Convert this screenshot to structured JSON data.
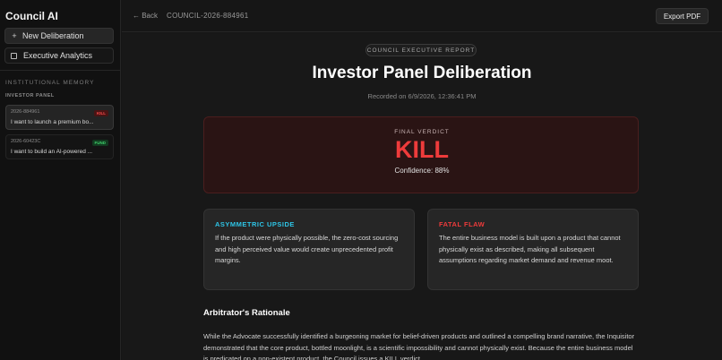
{
  "app": {
    "title": "Council AI"
  },
  "sidebar": {
    "new_label": "New Deliberation",
    "new_icon": "+",
    "analytics_label": "Executive Analytics",
    "memory_title": "INSTITUTIONAL MEMORY",
    "panel_title": "INVESTOR PANEL",
    "sessions": [
      {
        "id": "2026-884961",
        "text": "I want to launch a premium bo...",
        "badge": "KILL",
        "active": true
      },
      {
        "id": "2026-60423C",
        "text": "I want to build an AI-powered ...",
        "badge": "FUND",
        "active": false
      }
    ]
  },
  "topbar": {
    "back_label": "← Back",
    "crumb": "COUNCIL-2026-884961",
    "export_label": "Export PDF"
  },
  "report": {
    "tag": "COUNCIL EXECUTIVE REPORT",
    "title": "Investor Panel Deliberation",
    "recorded": "Recorded on 6/9/2026, 12:36:41 PM",
    "verdict_label": "FINAL VERDICT",
    "verdict": "KILL",
    "confidence": "Confidence: 88%",
    "upside_title": "ASYMMETRIC UPSIDE",
    "upside_body": "If the product were physically possible, the zero-cost sourcing and high perceived value would create unprecedented profit margins.",
    "flaw_title": "FATAL FLAW",
    "flaw_body": "The entire business model is built upon a product that cannot physically exist as described, making all subsequent assumptions regarding market demand and revenue moot.",
    "rationale_title": "Arbitrator's Rationale",
    "rationale_body": "While the Advocate successfully identified a burgeoning market for belief-driven products and outlined a compelling brand narrative, the Inquisitor demonstrated that the core product, bottled moonlight, is a scientific impossibility and cannot physically exist. Because the entire business model is predicated on a non-existent product, the Council issues a KILL verdict."
  },
  "colors": {
    "kill": "#ee3b3b",
    "fund": "#3ecf6a",
    "upside": "#2ec4e6"
  }
}
